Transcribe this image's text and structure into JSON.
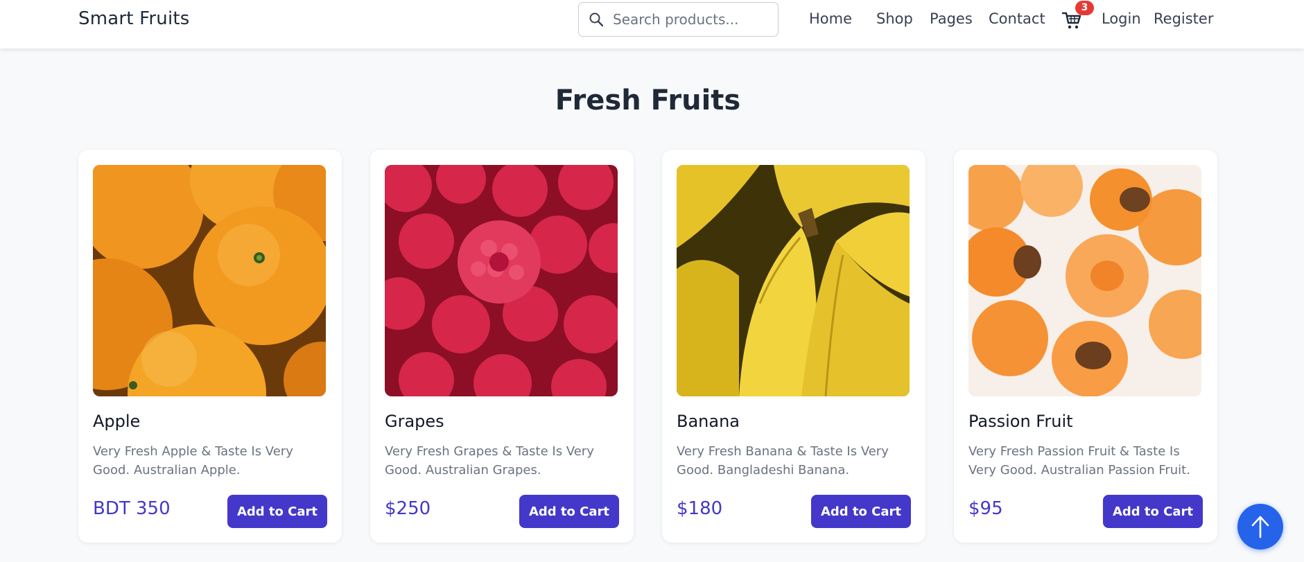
{
  "header": {
    "brand": "Smart Fruits",
    "search": {
      "placeholder": "Search products..."
    },
    "nav": {
      "home": "Home",
      "shop": "Shop",
      "pages": "Pages",
      "contact": "Contact",
      "login": "Login",
      "register": "Register"
    },
    "cart_count": "3",
    "cart_icon": "cart-icon"
  },
  "main": {
    "title": "Fresh Fruits",
    "products": [
      {
        "name": "Apple",
        "description": "Very Fresh Apple & Taste Is Very Good. Australian Apple.",
        "price": "BDT 350",
        "button": "Add to Cart",
        "image": "oranges-photo"
      },
      {
        "name": "Grapes",
        "description": "Very Fresh Grapes & Taste Is Very Good. Australian Grapes.",
        "price": "$250",
        "button": "Add to Cart",
        "image": "raspberries-photo"
      },
      {
        "name": "Banana",
        "description": "Very Fresh Banana & Taste Is Very Good. Bangladeshi Banana.",
        "price": "$180",
        "button": "Add to Cart",
        "image": "bananas-photo"
      },
      {
        "name": "Passion Fruit",
        "description": "Very Fresh Passion Fruit & Taste Is Very Good. Australian Passion Fruit.",
        "price": "$95",
        "button": "Add to Cart",
        "image": "apricots-photo"
      }
    ]
  },
  "colors": {
    "accent": "#4338ca",
    "scroll_button": "#2563eb",
    "badge": "#e53935",
    "background": "#f8f9fb"
  },
  "icons": {
    "search": "search-icon",
    "scroll_top": "arrow-up-icon"
  }
}
